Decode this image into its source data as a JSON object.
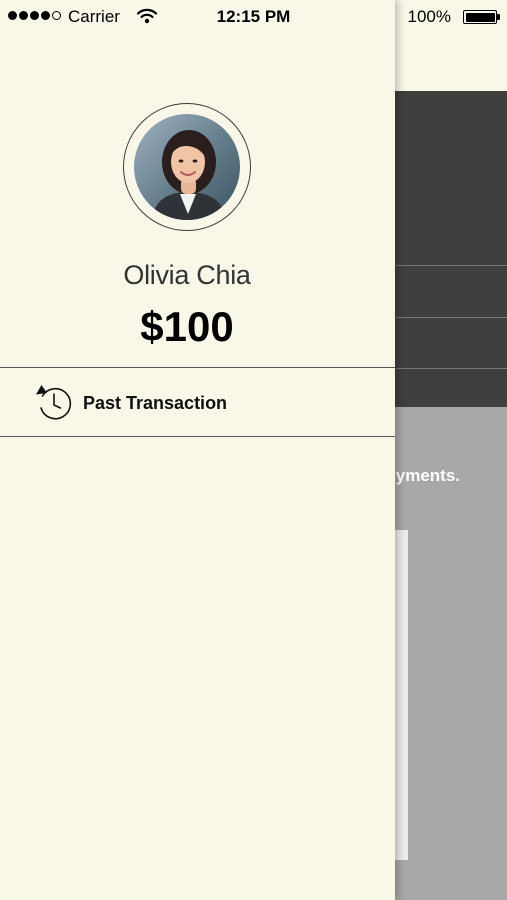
{
  "status_bar": {
    "carrier": "Carrier",
    "time": "12:15 PM",
    "battery": "100%",
    "signal_bars": 4,
    "signal_total": 5
  },
  "profile": {
    "name": "Olivia Chia",
    "balance": "$100"
  },
  "menu": {
    "items": [
      {
        "label": "Past Transaction",
        "icon": "history-icon"
      }
    ]
  },
  "background": {
    "partial_text": "yments."
  },
  "colors": {
    "drawer_bg": "#f9f7e8",
    "dark_panel": "#3f3f3f",
    "gray_panel": "#a8a8a8"
  }
}
